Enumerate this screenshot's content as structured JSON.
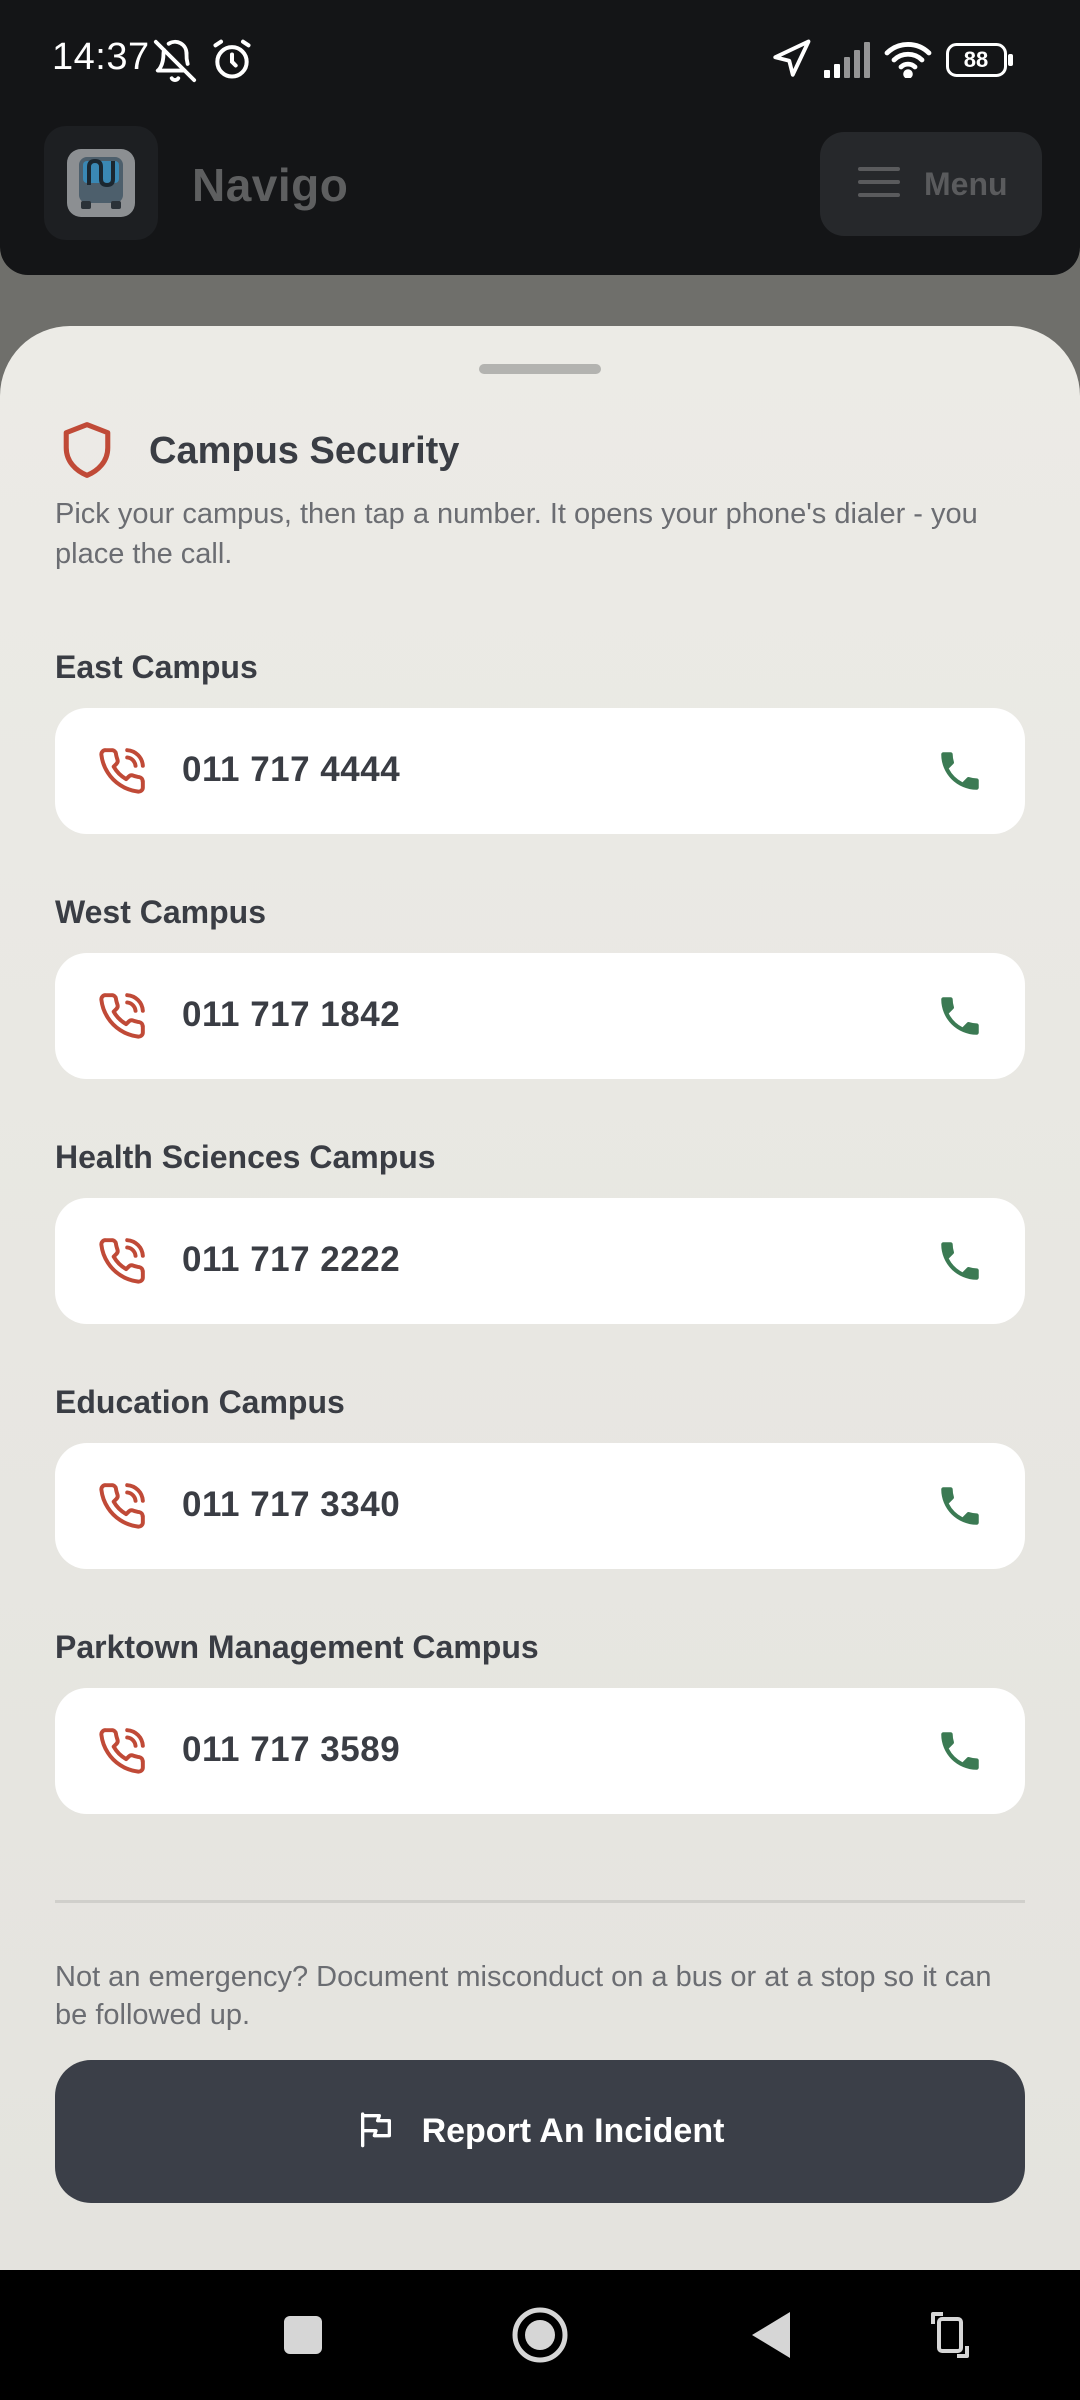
{
  "status_bar": {
    "time": "14:37",
    "battery": "88",
    "icons": [
      "bell-off-icon",
      "alarm-icon",
      "location-arrow-icon",
      "signal-icon",
      "wifi-icon",
      "battery-icon"
    ]
  },
  "app_header": {
    "title": "Navigo",
    "logo_icon": "bus-logo-icon",
    "menu_label": "Menu"
  },
  "sheet": {
    "title": "Campus Security",
    "title_icon": "shield-icon",
    "description": "Pick your campus, then tap a number. It opens your phone's dialer - you place the call.",
    "campuses": [
      {
        "name": "East Campus",
        "number": "011 717 4444"
      },
      {
        "name": "West Campus",
        "number": "011 717 1842"
      },
      {
        "name": "Health Sciences Campus",
        "number": "011 717 2222"
      },
      {
        "name": "Education Campus",
        "number": "011 717 3340"
      },
      {
        "name": "Parktown Management Campus",
        "number": "011 717 3589"
      }
    ],
    "footer_note": "Not an emergency? Document misconduct on a bus or at a stop so it can be followed up.",
    "report_button_label": "Report An Incident"
  },
  "colors": {
    "accent_red": "#c04a37",
    "call_green": "#3b7a53",
    "button_dark": "#3b3f48"
  }
}
